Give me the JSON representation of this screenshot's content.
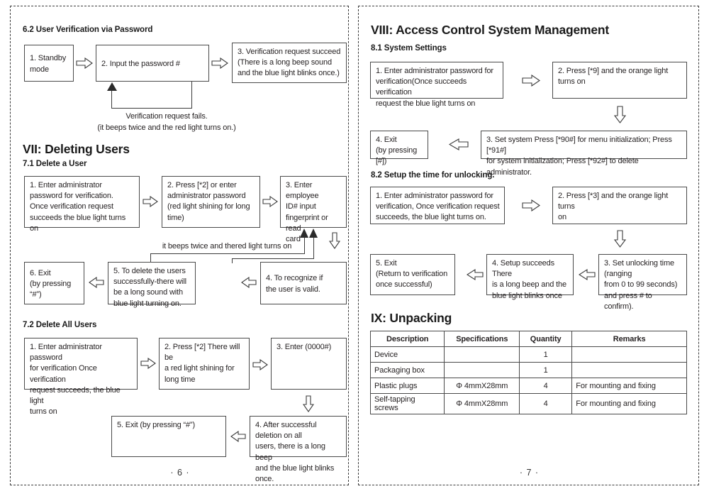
{
  "document": {
    "left_page": {
      "page_number": "· 6 ·",
      "section_62": {
        "heading": "6.2 User Verification via Password",
        "boxes": [
          "1. Standby\nmode",
          "2. Input the password #",
          "3. Verification request succeed\n(There is a long beep sound\nand the blue light blinks once.)"
        ],
        "feedback_caption": "Verification request fails.\n(it beeps twice and the red light turns on.)"
      },
      "section_vii": {
        "heading": "VII: Deleting Users",
        "section_71": {
          "heading": "7.1 Delete a User",
          "boxes": [
            "1. Enter administrator\npassword for verification.\nOnce verification request\nsucceeds the blue light turns on",
            "2. Press [*2] or enter\nadministrator password\n(red light shining for long\ntime)",
            "3. Enter employee\nID# input\nfingerprint or read\ncard",
            "4. To recognize if\nthe user is valid.",
            "5. To delete the users\nsuccessfully-there will\nbe a long sound with\nblue light turning on.",
            "6. Exit\n(by pressing “#”)"
          ],
          "feedback_caption": "it beeps twice and thered light turns on"
        },
        "section_72": {
          "heading": "7.2 Delete All Users",
          "boxes": [
            "1. Enter administrator password\nfor verification Once verification\nrequest succeeds, the blue light\nturns on",
            "2. Press [*2] There will be\na red light shining for\nlong time",
            "3. Enter (0000#)",
            "4. After successful deletion on all\nusers, there is a long beep\nand the blue light blinks once.",
            "5. Exit (by pressing “#”)"
          ]
        }
      }
    },
    "right_page": {
      "page_number": "· 7 ·",
      "section_viii": {
        "heading": "VIII: Access Control System Management",
        "section_81": {
          "heading": "8.1 System Settings",
          "boxes": [
            "1. Enter administrator password for\nverification(Once succeeds verification\nrequest the blue light turns on",
            "2. Press [*9] and the orange light\nturns on",
            "3. Set system Press [*90#] for menu initialization; Press [*91#]\nfor system initialization; Press [*92#] to delete administrator.",
            "4. Exit\n(by pressing [#])"
          ]
        },
        "section_82": {
          "heading": "8.2 Setup the time for unlocking.",
          "boxes": [
            "1. Enter administrator password for\nverification, Once verification request\nsucceeds, the blue light turns on.",
            "2. Press [*3] and the orange light turns\non",
            "3. Set unlocking time (ranging\nfrom 0 to 99 seconds)\nand press # to confirm).",
            "4. Setup succeeds There\nis a long beep and the\nblue light blinks once",
            "5. Exit\n(Return to verification\nonce successful)"
          ]
        }
      },
      "section_ix": {
        "heading": "IX: Unpacking",
        "table": {
          "columns": [
            "Description",
            "Specifications",
            "Quantity",
            "Remarks"
          ],
          "rows": [
            [
              "Device",
              "",
              "1",
              ""
            ],
            [
              "Packaging box",
              "",
              "1",
              ""
            ],
            [
              "Plastic plugs",
              "Φ 4mmX28mm",
              "4",
              "For mounting and fixing"
            ],
            [
              "Self-tapping screws",
              "Φ 4mmX28mm",
              "4",
              "For mounting and fixing"
            ]
          ]
        }
      }
    }
  },
  "colors": {
    "text": "#231f20",
    "box_border": "#4a4a4a",
    "page_border": "#3a3a3a",
    "arrow_outline": "#3b3b3b",
    "background": "#ffffff"
  }
}
